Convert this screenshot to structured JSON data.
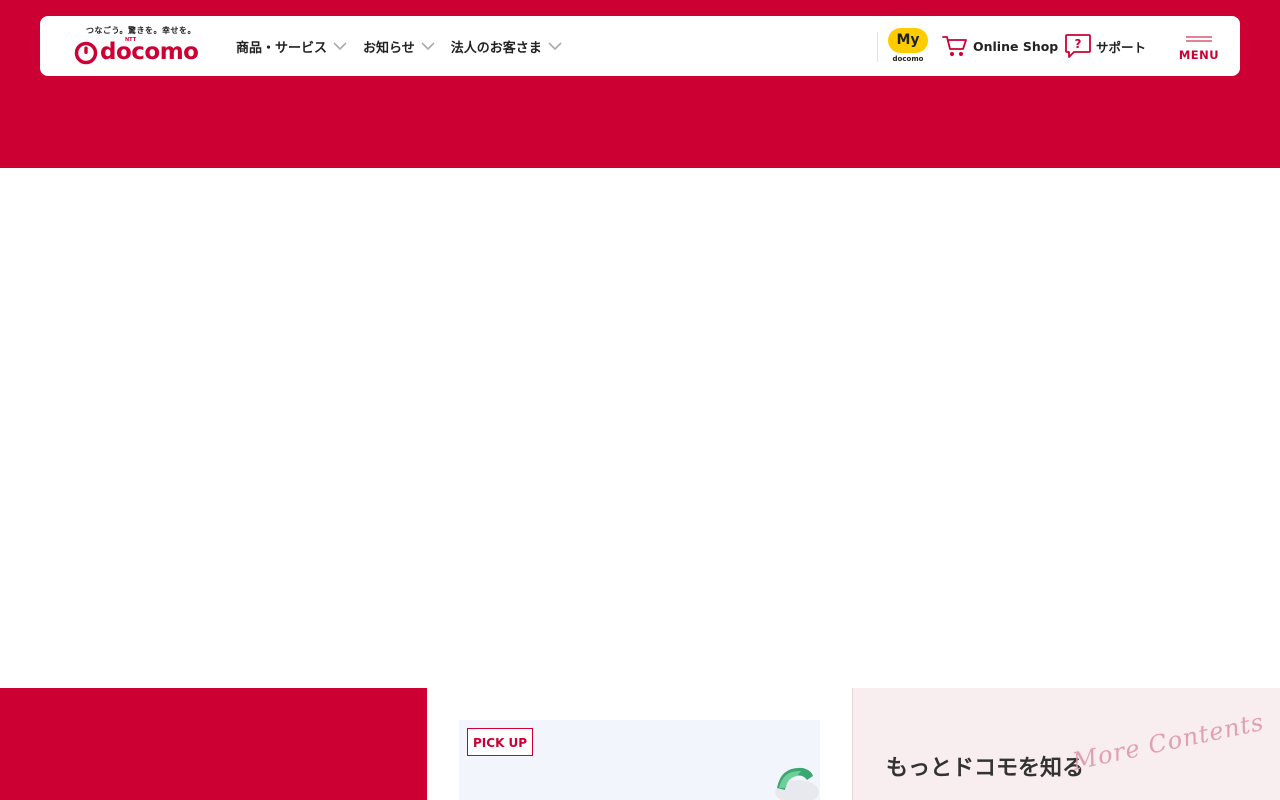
{
  "brand": {
    "tagline": "つなごう。驚きを。幸せを。",
    "ntt": "NTT",
    "wordmark": "docomo",
    "color": "#cc0033"
  },
  "nav": {
    "items": [
      {
        "label": "商品・サービス",
        "icon": "chevron-down-icon"
      },
      {
        "label": "お知らせ",
        "icon": "chevron-down-icon"
      },
      {
        "label": "法人のお客さま",
        "icon": "chevron-down-icon"
      }
    ]
  },
  "utility": {
    "my_docomo_badge": "My",
    "my_docomo_sub": "docomo",
    "online_shop": "Online Shop",
    "support": "サポート",
    "menu": "MENU"
  },
  "bottom": {
    "pickup_tag": "PICK UP",
    "more_title": "もっとドコモを知る",
    "more_script": "More Contents"
  },
  "colors": {
    "accent": "#cc0033",
    "my_badge": "#ffcc00",
    "pickup_bg": "#f2f6fc",
    "more_bg": "#f8eef0"
  }
}
